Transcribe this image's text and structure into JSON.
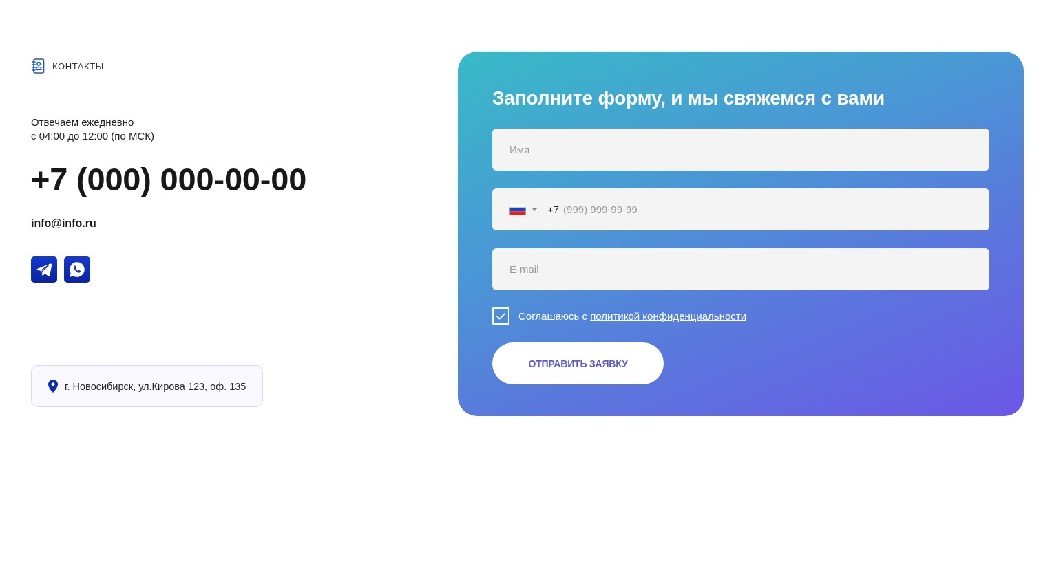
{
  "contacts": {
    "section_label": "КОНТАКТЫ",
    "hours": [
      "Отвечаем ежедневно",
      "с 04:00 до 12:00 (по МСК)"
    ],
    "phone": "+7 (000) 000-00-00",
    "email": "info@info.ru",
    "messengers": [
      {
        "kind": "plane"
      },
      {
        "kind": "phone-chat"
      }
    ],
    "address": "г. Новосибирск, ул.Кирова 123, оф. 135"
  },
  "form": {
    "title": "Заполните форму, и мы свяжемся с вами",
    "fields": [
      {
        "kind": "name",
        "placeholder": "Имя"
      },
      {
        "kind": "phone",
        "prefix": "+7",
        "placeholder": "(999) 999-99-99"
      },
      {
        "kind": "email",
        "placeholder": "E-mail"
      }
    ],
    "consent": {
      "checked": true,
      "text": "Соглашаюсь с ",
      "link": "политикой конфиденциальности"
    },
    "submit": "ОТПРАВИТЬ ЗАЯВКУ"
  }
}
